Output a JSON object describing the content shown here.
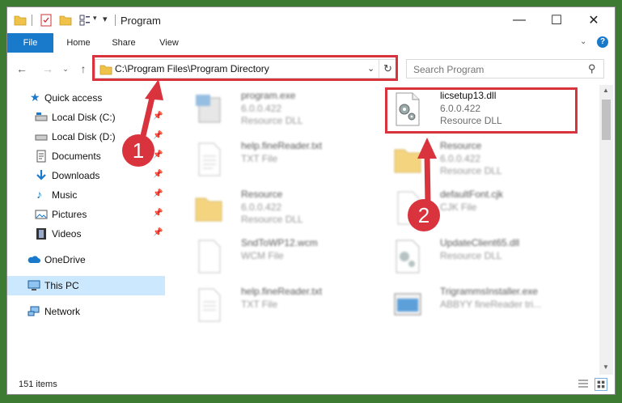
{
  "window": {
    "title": "Program",
    "minimize": "—",
    "maximize": "☐",
    "close": "✕"
  },
  "ribbon": {
    "tabs": [
      "File",
      "Home",
      "Share",
      "View"
    ],
    "help": "?"
  },
  "address": {
    "path": "C:\\Program Files\\Program Directory"
  },
  "search": {
    "placeholder": "Search Program"
  },
  "sidebar": {
    "quick_access": "Quick access",
    "items": [
      "Local Disk (C:)",
      "Local Disk (D:)",
      "Documents",
      "Downloads",
      "Music",
      "Pictures",
      "Videos"
    ],
    "onedrive": "OneDrive",
    "this_pc": "This PC",
    "network": "Network"
  },
  "files": [
    {
      "name": "program.exe",
      "s1": "6.0.0.422",
      "s2": "Resource DLL"
    },
    {
      "name": "licsetup13.dll",
      "s1": "6.0.0.422",
      "s2": "Resource DLL"
    },
    {
      "name": "help.fineReader.txt",
      "s1": "TXT File",
      "s2": ""
    },
    {
      "name": "Resource",
      "s1": "6.0.0.422",
      "s2": "Resource DLL"
    },
    {
      "name": "Resource",
      "s1": "6.0.0.422",
      "s2": "Resource DLL"
    },
    {
      "name": "defaultFont.cjk",
      "s1": "CJK File",
      "s2": ""
    },
    {
      "name": "SndToWP12.wcm",
      "s1": "WCM File",
      "s2": ""
    },
    {
      "name": "UpdateClient65.dll",
      "s1": "Resource DLL",
      "s2": ""
    },
    {
      "name": "help.fineReader.txt",
      "s1": "TXT File",
      "s2": ""
    },
    {
      "name": "TrigrammsInstaller.exe",
      "s1": "ABBYY fineReader tri...",
      "s2": ""
    }
  ],
  "status": {
    "count": "151 items"
  },
  "annotations": {
    "step1": "1",
    "step2": "2",
    "color": "#d9343e"
  }
}
